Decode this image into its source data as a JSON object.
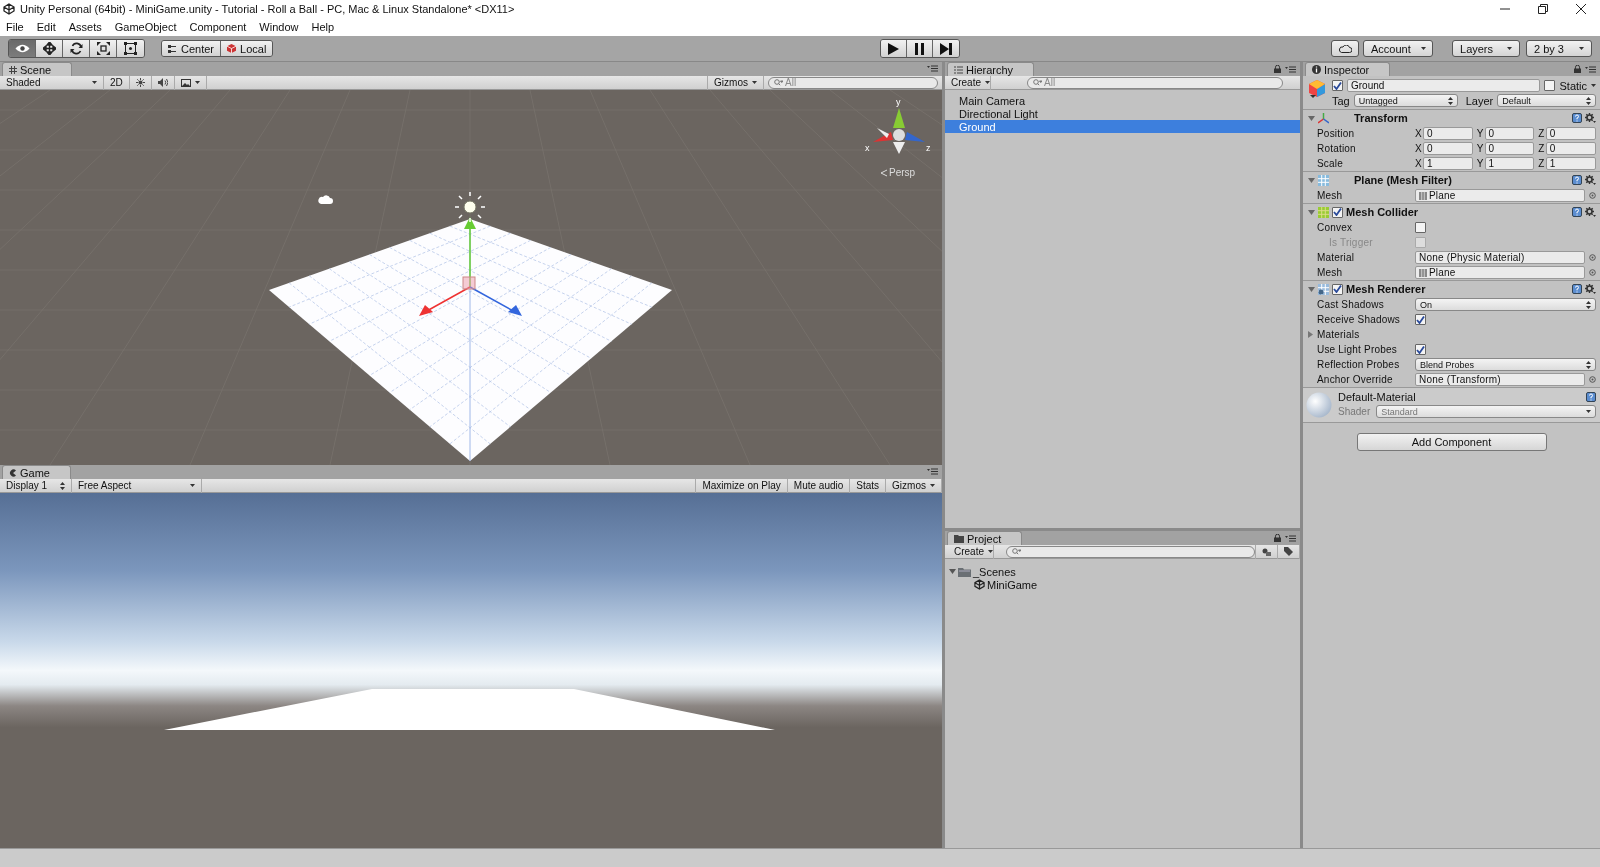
{
  "window": {
    "title": "Unity Personal (64bit) - MiniGame.unity - Tutorial - Roll a Ball - PC, Mac & Linux Standalone* <DX11>"
  },
  "menu": [
    "File",
    "Edit",
    "Assets",
    "GameObject",
    "Component",
    "Window",
    "Help"
  ],
  "toolbar": {
    "tools": [
      {
        "kind": "view",
        "selected": true
      },
      {
        "kind": "move",
        "selected": false
      },
      {
        "kind": "rotate",
        "selected": false
      },
      {
        "kind": "scale",
        "selected": false
      },
      {
        "kind": "rect",
        "selected": false
      }
    ],
    "pivot": [
      {
        "kind": "pivot",
        "label": "Center"
      },
      {
        "kind": "space",
        "label": "Local"
      }
    ],
    "playback": [
      {
        "kind": "play"
      },
      {
        "kind": "pause"
      },
      {
        "kind": "step"
      }
    ],
    "account": "Account",
    "layers": "Layers",
    "layout": "2 by 3"
  },
  "scene": {
    "tab": "Scene",
    "shading": "Shaded",
    "mode_2d": "2D",
    "gizmos": "Gizmos",
    "search_placeholder": "All",
    "axes": [
      "y",
      "x",
      "z"
    ],
    "projection": "Persp"
  },
  "game": {
    "tab": "Game",
    "display": "Display 1",
    "aspect": "Free Aspect",
    "options": [
      "Maximize on Play",
      "Mute audio",
      "Stats",
      "Gizmos"
    ]
  },
  "hierarchy": {
    "tab": "Hierarchy",
    "create": "Create",
    "search_placeholder": "All",
    "items": [
      {
        "label": "Main Camera",
        "selected": false
      },
      {
        "label": "Directional Light",
        "selected": false
      },
      {
        "label": "Ground",
        "selected": true
      }
    ]
  },
  "project": {
    "tab": "Project",
    "create": "Create",
    "tree": [
      {
        "kind": "folder",
        "label": "_Scenes",
        "expanded": true,
        "children": [
          {
            "kind": "scene",
            "label": "MiniGame"
          }
        ]
      }
    ]
  },
  "inspector": {
    "tab": "Inspector",
    "object": {
      "name": "Ground",
      "active": true,
      "static": false,
      "static_label": "Static",
      "tag_label": "Tag",
      "tag": "Untagged",
      "layer_label": "Layer",
      "layer": "Default"
    },
    "components": [
      {
        "kind": "transform",
        "name": "Transform",
        "expanded": true,
        "rows": [
          {
            "kind": "vector",
            "label": "Position",
            "values": [
              {
                "axis": "X",
                "value": "0"
              },
              {
                "axis": "Y",
                "value": "0"
              },
              {
                "axis": "Z",
                "value": "0"
              }
            ]
          },
          {
            "kind": "vector",
            "label": "Rotation",
            "values": [
              {
                "axis": "X",
                "value": "0"
              },
              {
                "axis": "Y",
                "value": "0"
              },
              {
                "axis": "Z",
                "value": "0"
              }
            ]
          },
          {
            "kind": "vector",
            "label": "Scale",
            "values": [
              {
                "axis": "X",
                "value": "1"
              },
              {
                "axis": "Y",
                "value": "1"
              },
              {
                "axis": "Z",
                "value": "1"
              }
            ]
          }
        ]
      },
      {
        "kind": "filter",
        "name": "Plane (Mesh Filter)",
        "expanded": true,
        "rows": [
          {
            "kind": "object",
            "label": "Mesh",
            "value": "Plane",
            "asset": true
          }
        ]
      },
      {
        "kind": "collider",
        "name": "Mesh Collider",
        "expanded": true,
        "enabled": true,
        "rows": [
          {
            "kind": "checkbox",
            "label": "Convex",
            "checked": false,
            "disabled": false
          },
          {
            "kind": "checkbox",
            "label": "Is Trigger",
            "checked": false,
            "disabled": true
          },
          {
            "kind": "object",
            "label": "Material",
            "value": "None (Physic Material)",
            "asset": false
          },
          {
            "kind": "object",
            "label": "Mesh",
            "value": "Plane",
            "asset": true
          }
        ]
      },
      {
        "kind": "renderer",
        "name": "Mesh Renderer",
        "expanded": true,
        "enabled": true,
        "rows": [
          {
            "kind": "dropdown",
            "label": "Cast Shadows",
            "value": "On"
          },
          {
            "kind": "checkbox",
            "label": "Receive Shadows",
            "checked": true,
            "disabled": false
          },
          {
            "kind": "foldout",
            "label": "Materials",
            "expanded": false
          },
          {
            "kind": "checkbox",
            "label": "Use Light Probes",
            "checked": true,
            "disabled": false
          },
          {
            "kind": "dropdown",
            "label": "Reflection Probes",
            "value": "Blend Probes"
          },
          {
            "kind": "object",
            "label": "Anchor Override",
            "value": "None (Transform)",
            "asset": false
          }
        ]
      }
    ],
    "material": {
      "name": "Default-Material",
      "shader_label": "Shader",
      "shader": "Standard"
    },
    "add_component": "Add Component"
  }
}
